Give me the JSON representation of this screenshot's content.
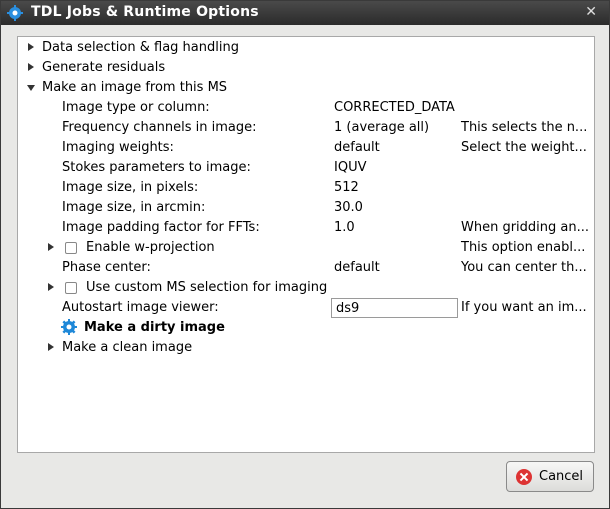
{
  "window": {
    "title": "TDL Jobs & Runtime Options",
    "close_glyph": "✕"
  },
  "tree": {
    "data_selection": "Data selection & flag handling",
    "generate_residuals": "Generate residuals",
    "make_image": "Make an image from this MS",
    "options": [
      {
        "label": "Image type or column:",
        "value": "CORRECTED_DATA",
        "desc": ""
      },
      {
        "label": "Frequency channels in image:",
        "value": "1 (average all)",
        "desc": "This selects the n..."
      },
      {
        "label": "Imaging weights:",
        "value": "default",
        "desc": "Select the weight..."
      },
      {
        "label": "Stokes parameters to image:",
        "value": "IQUV",
        "desc": ""
      },
      {
        "label": "Image size, in pixels:",
        "value": "512",
        "desc": ""
      },
      {
        "label": "Image size, in arcmin:",
        "value": "30.0",
        "desc": ""
      },
      {
        "label": "Image padding factor for FFTs:",
        "value": "1.0",
        "desc": "When gridding an..."
      }
    ],
    "w_projection": {
      "label": "Enable w-projection",
      "desc": "This option enabl..."
    },
    "phase_center": {
      "label": "Phase center:",
      "value": "default",
      "desc": "You can center th..."
    },
    "custom_ms": {
      "label": "Use custom MS selection for imaging"
    },
    "autostart": {
      "label": "Autostart image viewer:",
      "value": "ds9",
      "desc": "If you want an im..."
    },
    "dirty_image": "Make a dirty image",
    "clean_image": "Make a clean image"
  },
  "buttons": {
    "cancel": "Cancel"
  },
  "colors": {
    "titlebar": "#2b2b2b",
    "gear": "#1e88d8",
    "cancel_icon": "#dd3333"
  }
}
